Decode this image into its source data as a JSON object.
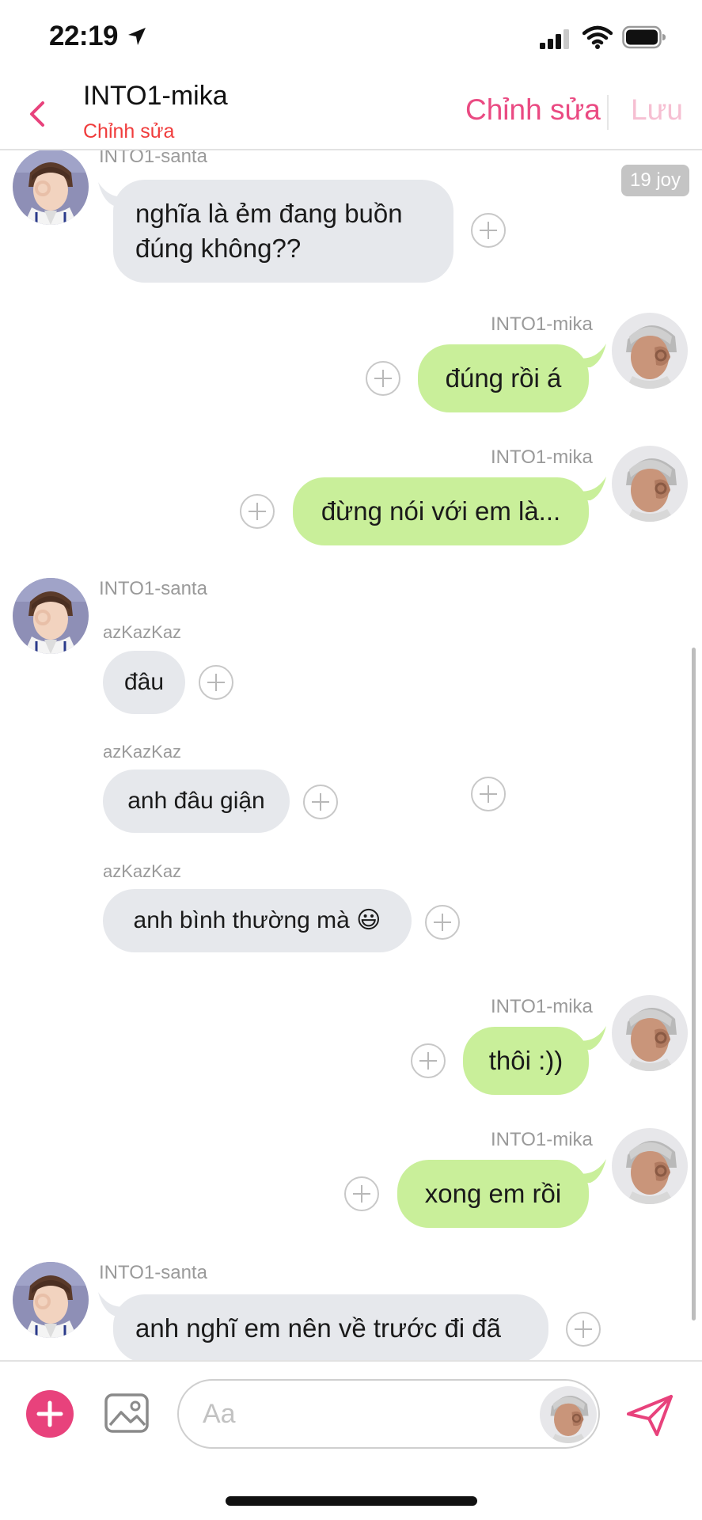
{
  "status_bar": {
    "time": "22:19"
  },
  "header": {
    "title": "INTO1-mika",
    "subtitle": "Chỉnh sửa",
    "edit_label": "Chỉnh sửa",
    "save_label": "Lưu"
  },
  "time_badge": "19 joy",
  "messages": [
    {
      "side": "left",
      "sender": "INTO1-santa",
      "text_lines": [
        "nghĩa là ẻm đang buồn",
        "đúng không??"
      ]
    },
    {
      "side": "right",
      "sender": "INTO1-mika",
      "text": "đúng rồi á"
    },
    {
      "side": "right",
      "sender": "INTO1-mika",
      "text": "đừng nói với em là..."
    },
    {
      "side": "left",
      "sender": "INTO1-santa",
      "group": [
        {
          "sub_sender": "azKazKaz",
          "text": "đâu"
        },
        {
          "sub_sender": "azKazKaz",
          "text": "anh đâu giận"
        },
        {
          "sub_sender": "azKazKaz",
          "text": "anh bình thường mà 😃"
        }
      ]
    },
    {
      "side": "right",
      "sender": "INTO1-mika",
      "text": "thôi :))"
    },
    {
      "side": "right",
      "sender": "INTO1-mika",
      "text": "xong em rồi"
    },
    {
      "side": "left",
      "sender": "INTO1-santa",
      "text": "anh nghĩ em nên về trước đi đã"
    }
  ],
  "input": {
    "placeholder": "Aa"
  },
  "colors": {
    "accent_pink": "#e8427c",
    "edit_pink": "#ea4a82",
    "save_pink_disabled": "#f6bfd2",
    "subtitle_red": "#f03c3c",
    "bubble_left": "#e6e8ec",
    "bubble_right": "#c9ef9a"
  },
  "icons": [
    "location-arrow-icon",
    "signal-icon",
    "wifi-icon",
    "battery-icon",
    "back-chevron-icon",
    "plus-circle-icon",
    "image-icon",
    "send-icon"
  ]
}
